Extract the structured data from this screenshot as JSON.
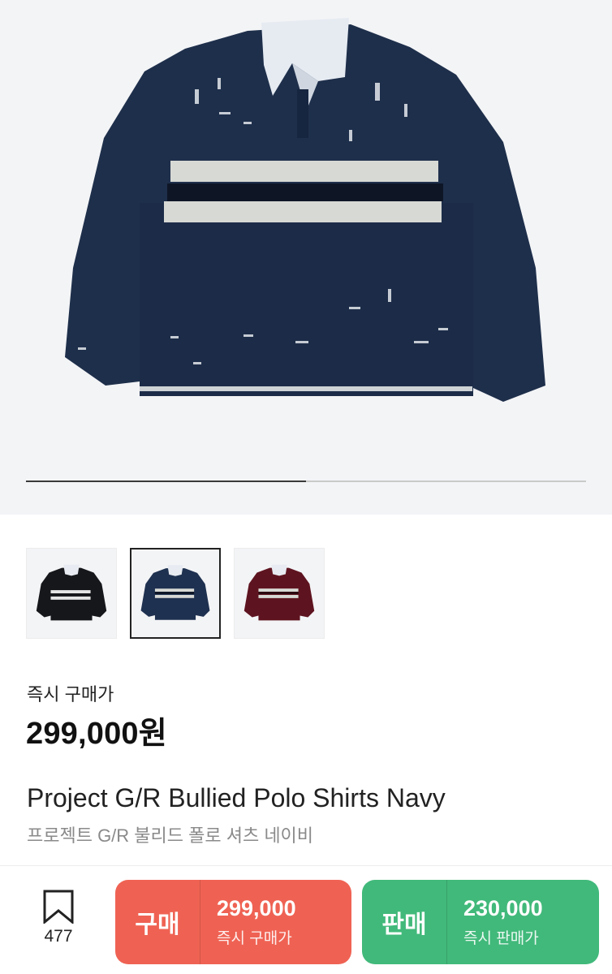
{
  "gallery": {
    "main_image": "navy-rugby-polo-shirt",
    "progress_fraction": 0.5,
    "thumbnails": [
      {
        "name": "black-variant",
        "color": "#15171a"
      },
      {
        "name": "navy-variant",
        "color": "#1f3150",
        "selected": true
      },
      {
        "name": "burgundy-variant",
        "color": "#5e1420"
      }
    ]
  },
  "pricing": {
    "label": "즉시 구매가",
    "price": "299,000원"
  },
  "product": {
    "title": "Project G/R Bullied Polo Shirts Navy",
    "subtitle": "프로젝트 G/R 불리드 폴로 셔츠 네이비"
  },
  "actions": {
    "bookmark_icon": "bookmark-icon",
    "bookmark_count": "477",
    "buy": {
      "kind": "구매",
      "amount": "299,000",
      "note": "즉시 구매가",
      "color": "#ef6253"
    },
    "sell": {
      "kind": "판매",
      "amount": "230,000",
      "note": "즉시 판매가",
      "color": "#41b97a"
    }
  }
}
